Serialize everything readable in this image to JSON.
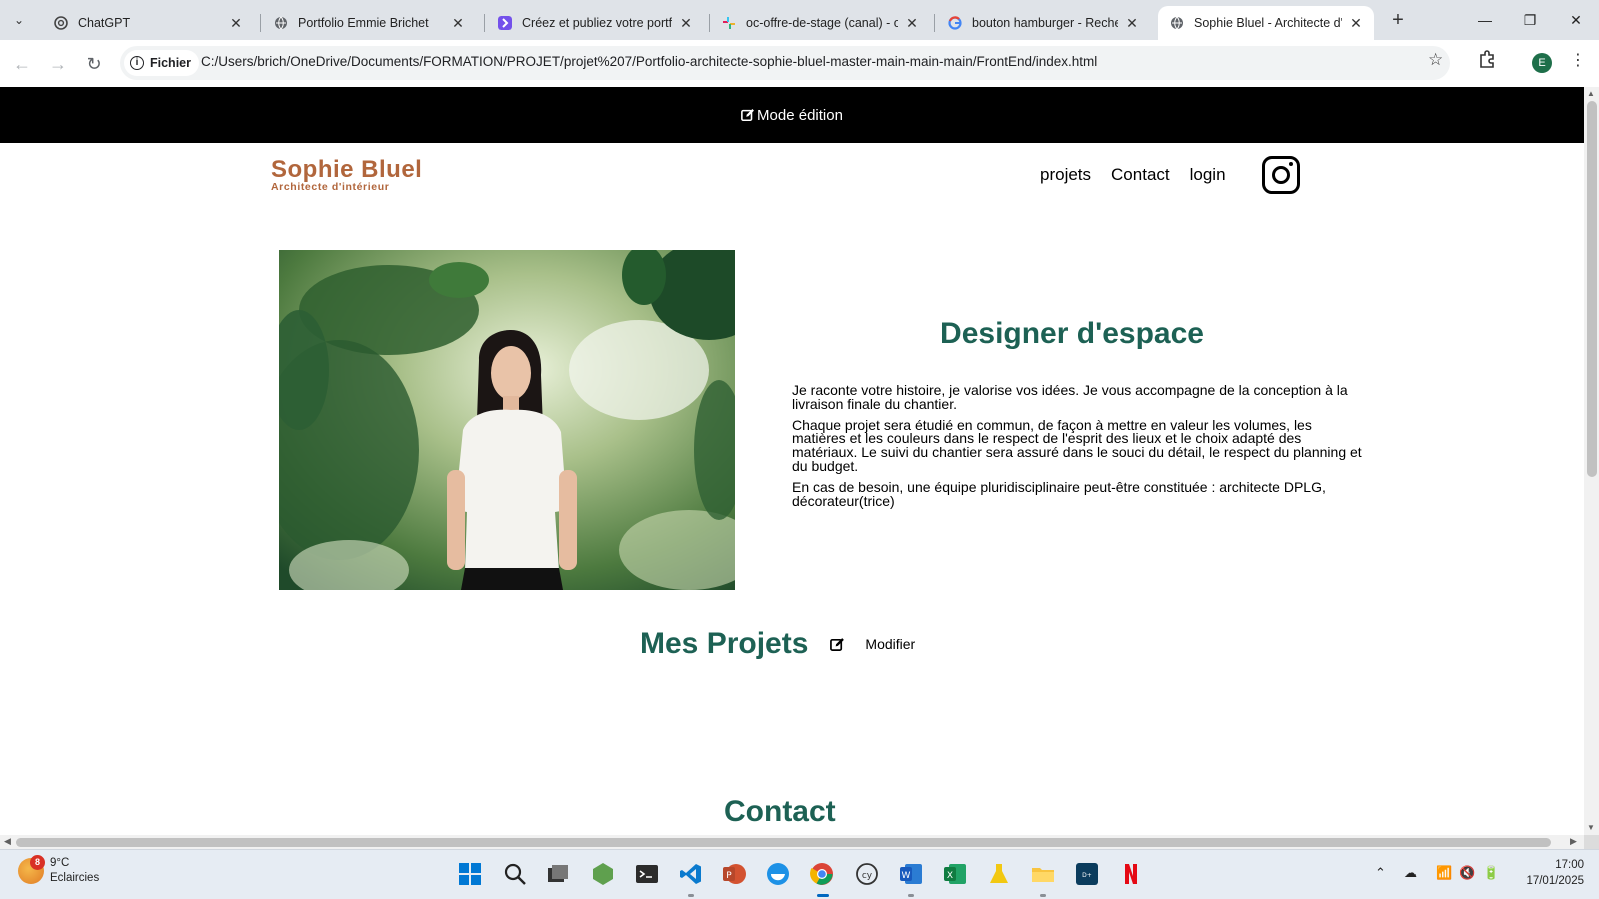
{
  "browser": {
    "tabs": [
      {
        "title": "ChatGPT",
        "active": false
      },
      {
        "title": "Portfolio Emmie Brichet",
        "active": false
      },
      {
        "title": "Créez et publiez votre portfo",
        "active": false
      },
      {
        "title": "oc-offre-de-stage (canal) - o",
        "active": false
      },
      {
        "title": "bouton hamburger - Recherc",
        "active": false
      },
      {
        "title": "Sophie Bluel - Architecte d'in",
        "active": true
      }
    ],
    "address": {
      "scheme_label": "Fichier",
      "url": "C:/Users/brich/OneDrive/Documents/FORMATION/PROJET/projet%207/Portfolio-architecte-sophie-bluel-master-main-main-main/FrontEnd/index.html"
    },
    "profile_initial": "E"
  },
  "page": {
    "edit_banner": "Mode édition",
    "logo": {
      "name": "Sophie Bluel",
      "subtitle": "Architecte d'intérieur"
    },
    "nav": [
      "projets",
      "Contact",
      "login"
    ],
    "intro": {
      "title": "Designer d'espace",
      "paragraphs": [
        "Je raconte votre histoire, je valorise vos idées. Je vous accompagne de la conception à la livraison finale du chantier.",
        "Chaque projet sera étudié en commun, de façon à mettre en valeur les volumes, les matières et les couleurs dans le respect de l'esprit des lieux et le choix adapté des matériaux. Le suivi du chantier sera assuré dans le souci du détail, le respect du planning et du budget.",
        "En cas de besoin, une équipe pluridisciplinaire peut-être constituée : architecte DPLG, décorateur(trice)"
      ]
    },
    "projects": {
      "title": "Mes Projets",
      "modify_label": "Modifier"
    },
    "contact": {
      "title": "Contact"
    }
  },
  "taskbar": {
    "weather": {
      "temp": "9°C",
      "condition": "Eclaircies",
      "badge": "8"
    },
    "clock": {
      "time": "17:00",
      "date": "17/01/2025"
    }
  },
  "colors": {
    "accent": "#1d6154",
    "logo": "#b1663c",
    "banner": "#000000"
  }
}
